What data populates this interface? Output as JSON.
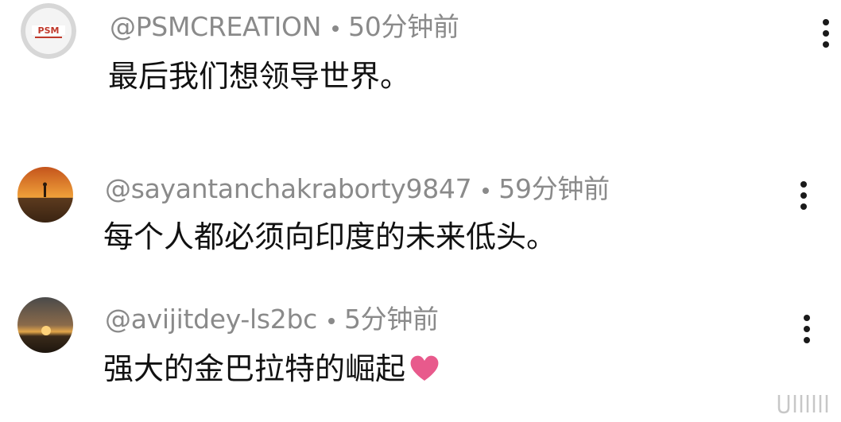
{
  "comments": [
    {
      "username": "@PSMCREATION",
      "time": "50分钟前",
      "text": "最后我们想领导世界。",
      "avatar_icon": "psm-logo-avatar"
    },
    {
      "username": "@sayantanchakraborty9847",
      "time": "59分钟前",
      "text": "每个人都必须向印度的未来低头。",
      "avatar_icon": "sunset-person-avatar"
    },
    {
      "username": "@avijitdey-ls2bc",
      "time": "5分钟前",
      "text": "强大的金巴拉特的崛起",
      "avatar_icon": "sunset-avatar",
      "emoji": "heart"
    }
  ],
  "colors": {
    "meta": "#8a8a8a",
    "text": "#111111",
    "heart": "#e85a8c"
  }
}
